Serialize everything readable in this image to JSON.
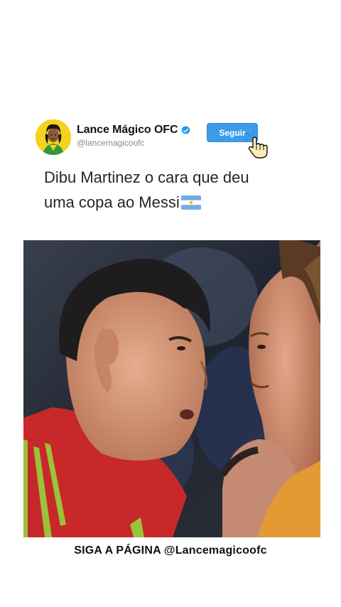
{
  "post": {
    "display_name": "Lance Mágico OFC",
    "handle": "@lancemagicoofc",
    "verified": true,
    "follow_label": "Seguir",
    "caption_line1": "Dibu Martinez o cara que deu",
    "caption_line2": "uma copa ao Messi",
    "caption_emoji": "argentina-flag-icon"
  },
  "footer": {
    "text": "SIGA A PÁGINA @Lancemagicoofc"
  },
  "colors": {
    "follow_button": "#3d9be9",
    "verified_badge": "#1d9bf0",
    "avatar_bg": "#f4d21f"
  },
  "icons": {
    "avatar": "profile-avatar",
    "verified": "verified-badge-icon",
    "cursor": "hand-pointer-icon"
  }
}
